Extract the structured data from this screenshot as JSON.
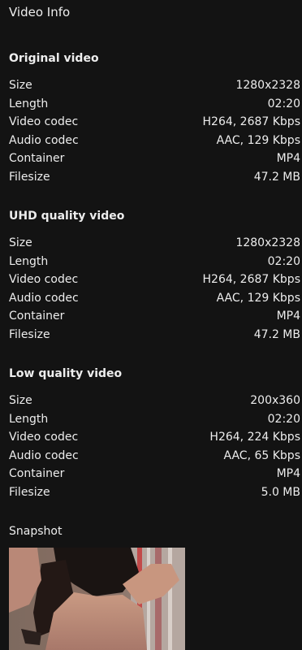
{
  "header": {
    "title": "Video Info"
  },
  "sections": [
    {
      "title": "Original video",
      "rows": [
        {
          "label": "Size",
          "value": "1280x2328"
        },
        {
          "label": "Length",
          "value": "02:20"
        },
        {
          "label": "Video codec",
          "value": "H264, 2687 Kbps"
        },
        {
          "label": "Audio codec",
          "value": "AAC, 129 Kbps"
        },
        {
          "label": "Container",
          "value": "MP4"
        },
        {
          "label": "Filesize",
          "value": "47.2 MB"
        }
      ]
    },
    {
      "title": "UHD quality video",
      "rows": [
        {
          "label": "Size",
          "value": "1280x2328"
        },
        {
          "label": "Length",
          "value": "02:20"
        },
        {
          "label": "Video codec",
          "value": "H264, 2687 Kbps"
        },
        {
          "label": "Audio codec",
          "value": "AAC, 129 Kbps"
        },
        {
          "label": "Container",
          "value": "MP4"
        },
        {
          "label": "Filesize",
          "value": "47.2 MB"
        }
      ]
    },
    {
      "title": "Low quality video",
      "rows": [
        {
          "label": "Size",
          "value": "200x360"
        },
        {
          "label": "Length",
          "value": "02:20"
        },
        {
          "label": "Video codec",
          "value": "H264, 224 Kbps"
        },
        {
          "label": "Audio codec",
          "value": "AAC, 65 Kbps"
        },
        {
          "label": "Container",
          "value": "MP4"
        },
        {
          "label": "Filesize",
          "value": "5.0 MB"
        }
      ]
    }
  ],
  "snapshot": {
    "label": "Snapshot"
  },
  "colors": {
    "background": "#131313",
    "text": "#ededed"
  }
}
